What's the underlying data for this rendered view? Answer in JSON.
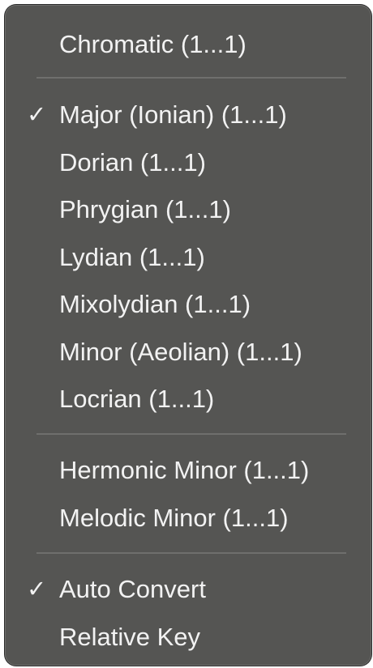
{
  "menu": {
    "items": [
      {
        "label": "Chromatic (1...1)",
        "checked": false
      },
      {
        "label": "Major (Ionian) (1...1)",
        "checked": true
      },
      {
        "label": "Dorian (1...1)",
        "checked": false
      },
      {
        "label": "Phrygian (1...1)",
        "checked": false
      },
      {
        "label": "Lydian (1...1)",
        "checked": false
      },
      {
        "label": "Mixolydian (1...1)",
        "checked": false
      },
      {
        "label": "Minor (Aeolian) (1...1)",
        "checked": false
      },
      {
        "label": "Locrian (1...1)",
        "checked": false
      },
      {
        "label": "Hermonic Minor (1...1)",
        "checked": false
      },
      {
        "label": "Melodic Minor (1...1)",
        "checked": false
      },
      {
        "label": "Auto Convert",
        "checked": true
      },
      {
        "label": "Relative Key",
        "checked": false
      }
    ],
    "check_glyph": "✓"
  },
  "colors": {
    "menu_background": "#555553",
    "text": "#f2f2f2",
    "separator": "#6f6f6d"
  }
}
